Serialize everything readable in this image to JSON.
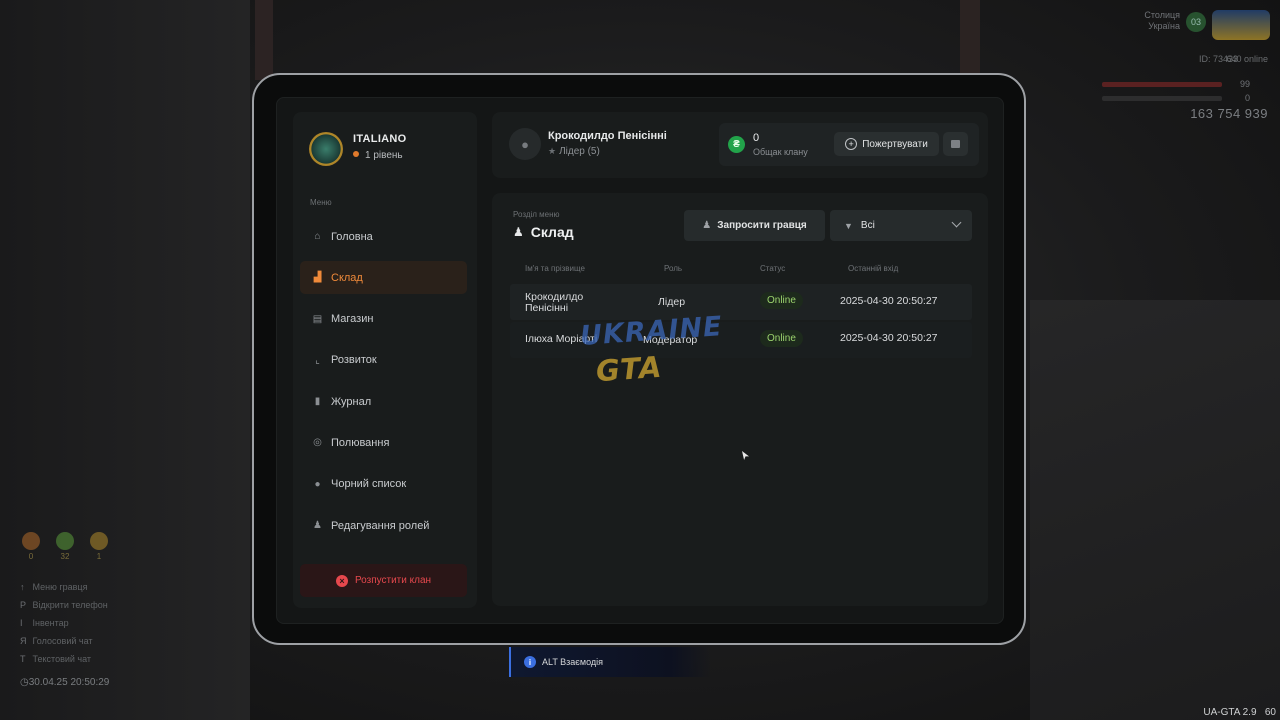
{
  "hud": {
    "server_line1": "Столиця",
    "server_line2": "Україна",
    "server_badge": "03",
    "player_id": "ID: 73433",
    "online": "640 online",
    "hp_value": "99",
    "armor_value": "0",
    "money": "163 754 939",
    "stats": [
      {
        "value": "0"
      },
      {
        "value": "32"
      },
      {
        "value": "1"
      }
    ],
    "hotkeys": [
      {
        "key": "↑",
        "label": "Меню гравця"
      },
      {
        "key": "P",
        "label": "Відкрити телефон"
      },
      {
        "key": "I",
        "label": "Інвентар"
      },
      {
        "key": "Я",
        "label": "Голосовий чат"
      },
      {
        "key": "T",
        "label": "Текстовий чат"
      }
    ],
    "datetime": "30.04.25 20:50:29",
    "version": "UA-GTA 2.9",
    "fps": "60"
  },
  "clan": {
    "name": "ITALIANO",
    "level": "1 рівень"
  },
  "sidebar": {
    "menu_caption": "Меню",
    "items": [
      {
        "label": "Головна",
        "icon": "home-icon",
        "active": false
      },
      {
        "label": "Склад",
        "icon": "warehouse-icon",
        "active": true
      },
      {
        "label": "Магазин",
        "icon": "shop-icon",
        "active": false
      },
      {
        "label": "Розвиток",
        "icon": "chart-icon",
        "active": false
      },
      {
        "label": "Журнал",
        "icon": "book-icon",
        "active": false
      },
      {
        "label": "Полювання",
        "icon": "target-icon",
        "active": false
      },
      {
        "label": "Чорний список",
        "icon": "block-icon",
        "active": false
      },
      {
        "label": "Редагування ролей",
        "icon": "user-icon",
        "active": false
      }
    ],
    "dissolve_label": "Розпустити клан"
  },
  "header": {
    "user_name": "Крокодилдо Пенісінні",
    "user_role": "Лідер (5)",
    "fund_value": "0",
    "fund_caption": "Общак клану",
    "donate_label": "Пожертвувати"
  },
  "main": {
    "section_caption": "Розділ меню",
    "section_title": "Склад",
    "invite_label": "Запросити гравця",
    "filter_value": "Всі",
    "columns": [
      "Ім'я та прізвище",
      "Роль",
      "Статус",
      "Останній вхід"
    ],
    "rows": [
      {
        "name": "Крокодилдо Пенісінні",
        "role": "Лідер",
        "status": "Online",
        "last_login": "2025-04-30 20:50:27"
      },
      {
        "name": "Ілюха Моріарті",
        "role": "Модератор",
        "status": "Online",
        "last_login": "2025-04-30 20:50:27"
      }
    ]
  },
  "watermark": {
    "line1": "UKRAINE",
    "line2": "GTA"
  },
  "prompt": {
    "text": "ALT Взаємодія"
  },
  "colors": {
    "accent": "#f08a3a",
    "danger": "#e5484d",
    "online": "#9bd36d",
    "coin": "#22a34a",
    "info": "#3b6fe0"
  }
}
